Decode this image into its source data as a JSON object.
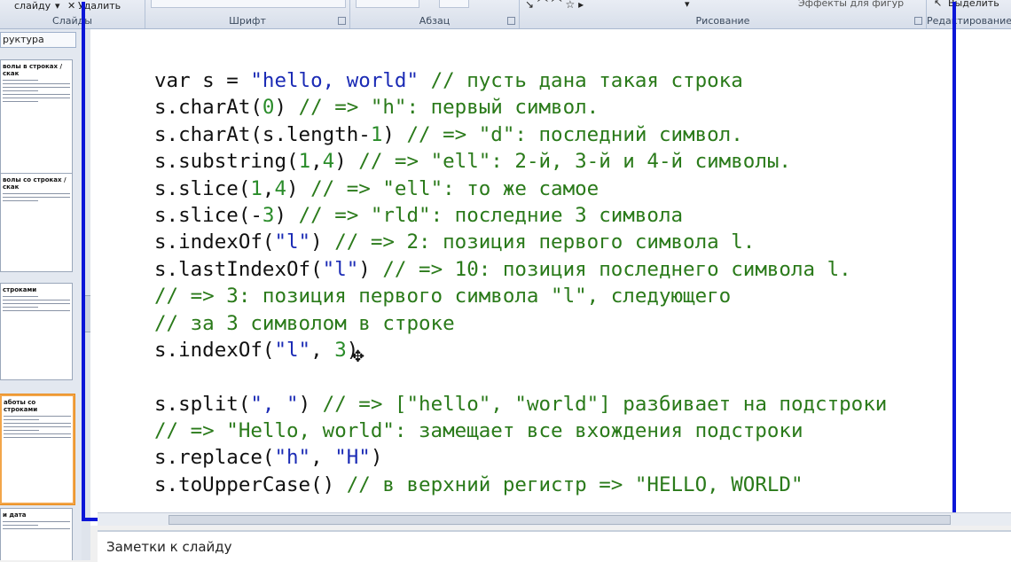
{
  "ribbon": {
    "slide_button_label": "слайду",
    "delete_button_label": "Удалить",
    "groups": {
      "slides": "Слайды",
      "font": "Шрифт",
      "paragraph": "Абзац",
      "drawing": "Рисование",
      "editing": "Редактирование"
    },
    "shape_effects_label": "Эффекты для фигур",
    "select_label": "Выделить"
  },
  "left_panel": {
    "tab_label": "руктура",
    "thumbnails": [
      {
        "title": "волы в строках / скак"
      },
      {
        "title": "волы со строках / скак"
      },
      {
        "title": "строками"
      },
      {
        "title": "аботы со строками"
      },
      {
        "title": "и дата"
      }
    ]
  },
  "slide": {
    "code_lines": [
      [
        {
          "t": "var s = ",
          "c": "plain"
        },
        {
          "t": "\"hello, world\"",
          "c": "str"
        },
        {
          "t": " // пусть дана такая строка",
          "c": "cmt"
        }
      ],
      [
        {
          "t": "s.charAt(",
          "c": "plain"
        },
        {
          "t": "0",
          "c": "num"
        },
        {
          "t": ") ",
          "c": "plain"
        },
        {
          "t": "// => \"h\": первый символ.",
          "c": "cmt"
        }
      ],
      [
        {
          "t": "s.charAt(s.length-",
          "c": "plain"
        },
        {
          "t": "1",
          "c": "num"
        },
        {
          "t": ") ",
          "c": "plain"
        },
        {
          "t": "// => \"d\": последний символ.",
          "c": "cmt"
        }
      ],
      [
        {
          "t": "s.substring(",
          "c": "plain"
        },
        {
          "t": "1",
          "c": "num"
        },
        {
          "t": ",",
          "c": "plain"
        },
        {
          "t": "4",
          "c": "num"
        },
        {
          "t": ") ",
          "c": "plain"
        },
        {
          "t": "// => \"ell\": 2-й, 3-й и 4-й символы.",
          "c": "cmt"
        }
      ],
      [
        {
          "t": "s.slice(",
          "c": "plain"
        },
        {
          "t": "1",
          "c": "num"
        },
        {
          "t": ",",
          "c": "plain"
        },
        {
          "t": "4",
          "c": "num"
        },
        {
          "t": ") ",
          "c": "plain"
        },
        {
          "t": "// => \"ell\": то же самое",
          "c": "cmt"
        }
      ],
      [
        {
          "t": "s.slice(-",
          "c": "plain"
        },
        {
          "t": "3",
          "c": "num"
        },
        {
          "t": ") ",
          "c": "plain"
        },
        {
          "t": "// => \"rld\": последние 3 символа",
          "c": "cmt"
        }
      ],
      [
        {
          "t": "s.indexOf(",
          "c": "plain"
        },
        {
          "t": "\"l\"",
          "c": "str"
        },
        {
          "t": ") ",
          "c": "plain"
        },
        {
          "t": "// => 2: позиция первого символа l.",
          "c": "cmt"
        }
      ],
      [
        {
          "t": "s.lastIndexOf(",
          "c": "plain"
        },
        {
          "t": "\"l\"",
          "c": "str"
        },
        {
          "t": ") ",
          "c": "plain"
        },
        {
          "t": "// => 10: позиция последнего символа l.",
          "c": "cmt"
        }
      ],
      [
        {
          "t": "// => 3: позиция первого символа \"l\", следующего",
          "c": "cmt"
        }
      ],
      [
        {
          "t": "// за 3 символом в строке",
          "c": "cmt"
        }
      ],
      [
        {
          "t": "s.indexOf(",
          "c": "plain"
        },
        {
          "t": "\"l\"",
          "c": "str"
        },
        {
          "t": ", ",
          "c": "plain"
        },
        {
          "t": "3",
          "c": "num"
        },
        {
          "t": ")",
          "c": "plain"
        }
      ],
      [],
      [
        {
          "t": "s.split(",
          "c": "plain"
        },
        {
          "t": "\", \"",
          "c": "str"
        },
        {
          "t": ") ",
          "c": "plain"
        },
        {
          "t": "// => [\"hello\", \"world\"] разбивает на подстроки",
          "c": "cmt"
        }
      ],
      [
        {
          "t": "// => \"Hello, world\": замещает все вхождения подстроки",
          "c": "cmt"
        }
      ],
      [
        {
          "t": "s.replace(",
          "c": "plain"
        },
        {
          "t": "\"h\"",
          "c": "str"
        },
        {
          "t": ", ",
          "c": "plain"
        },
        {
          "t": "\"H\"",
          "c": "str"
        },
        {
          "t": ")",
          "c": "plain"
        }
      ],
      [
        {
          "t": "s.toUpperCase() ",
          "c": "plain"
        },
        {
          "t": "// в верхний регистр => \"HELLO, WORLD\"",
          "c": "cmt"
        }
      ]
    ]
  },
  "notes": {
    "placeholder": "Заметки к слайду"
  },
  "colors": {
    "frame_border": "#0b16d8",
    "string": "#1b2bb5",
    "comment": "#2a7a1a"
  }
}
